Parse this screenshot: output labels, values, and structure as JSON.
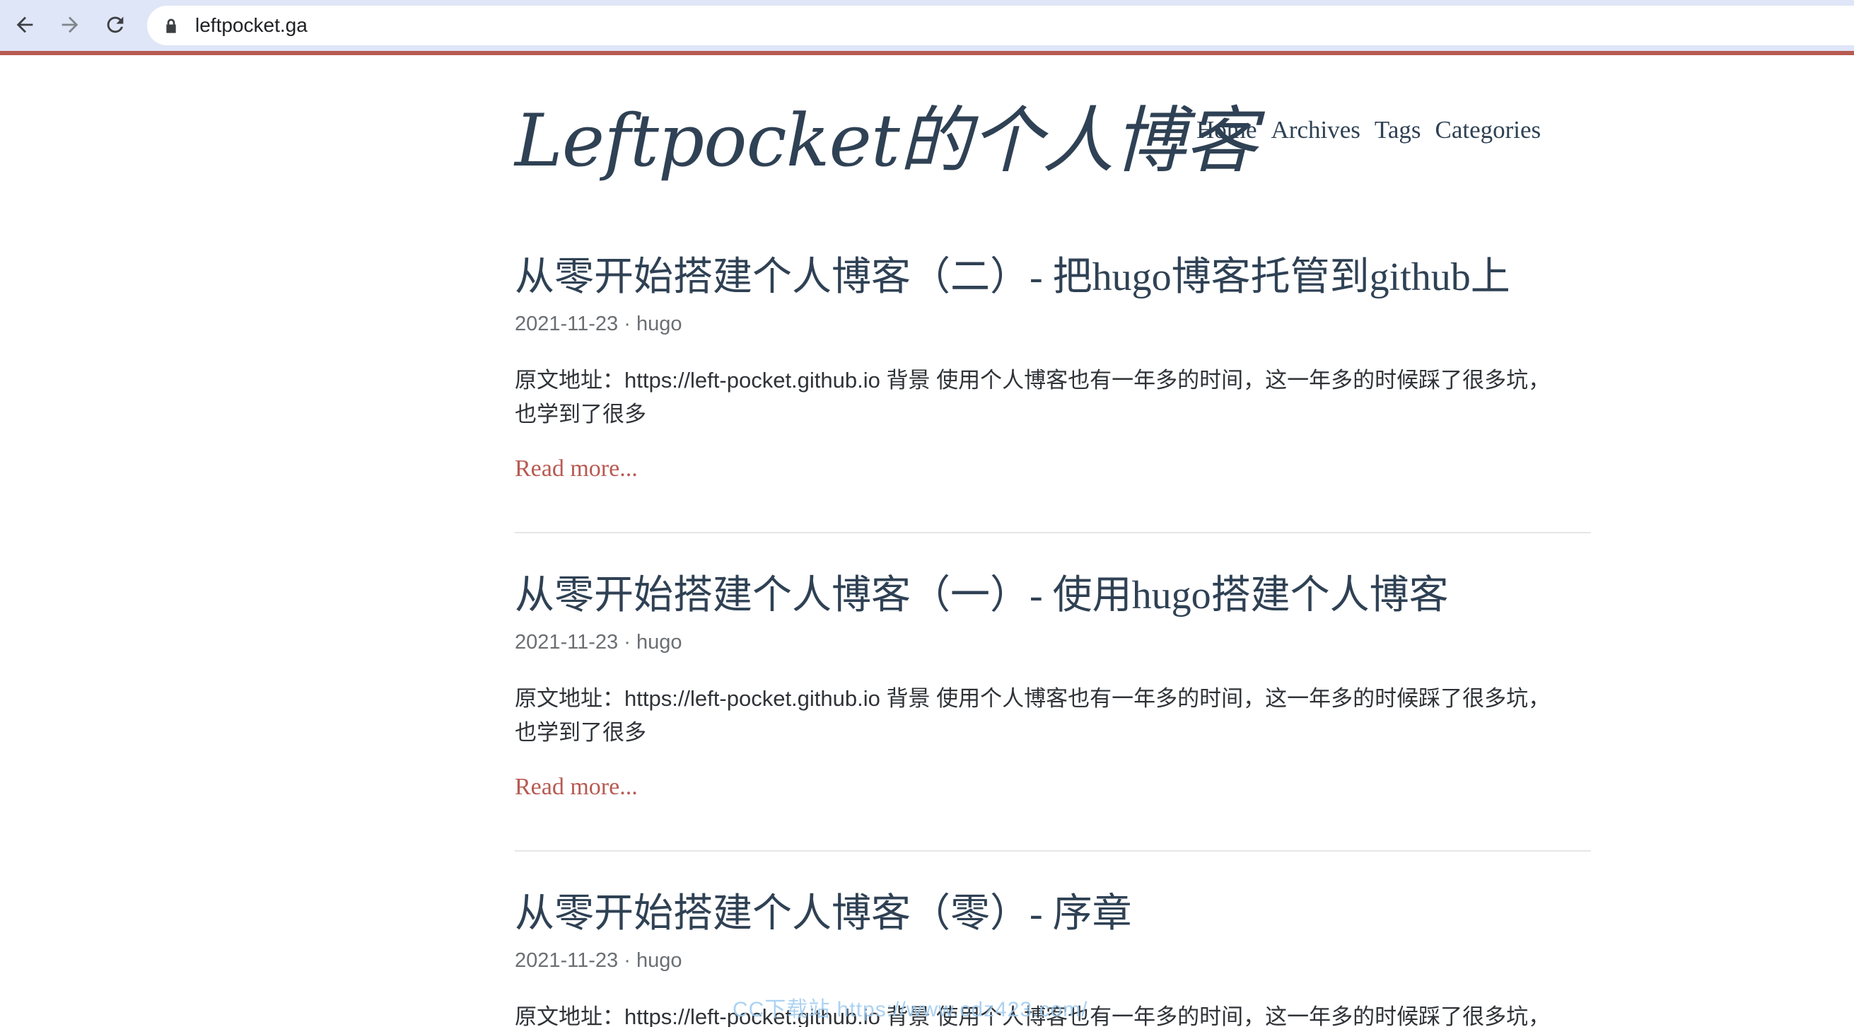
{
  "browser": {
    "url": "leftpocket.ga"
  },
  "site": {
    "title": "Leftpocket的个人博客",
    "nav": [
      "Home",
      "Archives",
      "Tags",
      "Categories"
    ]
  },
  "posts": [
    {
      "title": "从零开始搭建个人博客（二）- 把hugo博客托管到github上",
      "meta": "2021-11-23 · hugo",
      "summary": "原文地址：https://left-pocket.github.io 背景 使用个人博客也有一年多的时间，这一年多的时候踩了很多坑，也学到了很多",
      "read_more": "Read more..."
    },
    {
      "title": "从零开始搭建个人博客（一）- 使用hugo搭建个人博客",
      "meta": "2021-11-23 · hugo",
      "summary": "原文地址：https://left-pocket.github.io 背景 使用个人博客也有一年多的时间，这一年多的时候踩了很多坑，也学到了很多",
      "read_more": "Read more..."
    },
    {
      "title": "从零开始搭建个人博客（零）- 序章",
      "meta": "2021-11-23 · hugo",
      "summary": "原文地址：https://left-pocket.github.io 背景 使用个人博客也有一年多的时间，这一年多的时候踩了很多坑，也学到了很多"
    }
  ],
  "watermark": "CC下载站 https://www.cdz423.com/"
}
